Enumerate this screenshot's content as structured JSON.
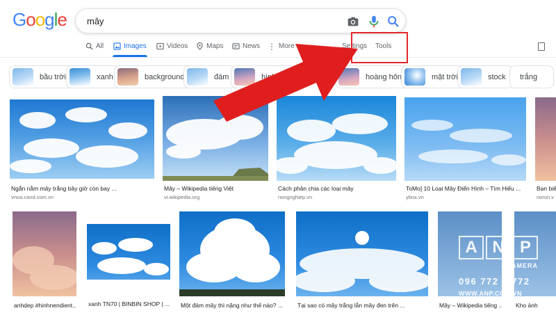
{
  "logo": {
    "letters": [
      "G",
      "o",
      "o",
      "g",
      "l",
      "e"
    ],
    "colors": [
      "#4285f4",
      "#ea4335",
      "#fbbc05",
      "#4285f4",
      "#34a853",
      "#ea4335"
    ]
  },
  "search": {
    "query": "mây",
    "camera_icon": "camera-icon",
    "mic_icon": "microphone-icon",
    "search_icon": "search-icon"
  },
  "nav": {
    "all": "All",
    "images": "Images",
    "videos": "Videos",
    "maps": "Maps",
    "news": "News",
    "more": "More",
    "settings": "Settings",
    "tools": "Tools"
  },
  "chips": [
    "bầu trời",
    "xanh",
    "background",
    "đám",
    "hình ảnh",
    "hoàng hôn",
    "mặt trời",
    "stock",
    "trắng"
  ],
  "results": [
    {
      "caption": "Ngắn nằm mây trắng bây giờ còn bay ...",
      "source": "vnoa.cand.com.vn"
    },
    {
      "caption": "Mây – Wikipedia tiếng Việt",
      "source": "vi.wikipedia.org"
    },
    {
      "caption": "Cách phân chia các loại mây",
      "source": "nongnghiep.vn"
    },
    {
      "caption": "ToMo] 10 Loại Mây Điển Hình – Tìm Hiểu ...",
      "source": "ybox.vn"
    },
    {
      "caption": "Bạn biế",
      "source": "noron.v"
    },
    {
      "caption": "anhdep #hinhnendient...",
      "source": ""
    },
    {
      "caption": "xanh TN70 | BINBIN SHOP | ...",
      "source": ""
    },
    {
      "caption": "Một đám mây thì nặng như thế nào? ...",
      "source": ""
    },
    {
      "caption": "Tại sao có mây trắng lẫn mây đen trên ...",
      "source": ""
    },
    {
      "caption": "Mây – Wikipedia tiếng ...",
      "source": ""
    },
    {
      "caption": "Kho ảnh",
      "source": ""
    }
  ],
  "watermark": {
    "letters": [
      "A",
      "N",
      "P"
    ],
    "tagline": "- CAMERA",
    "phone": "096 772 0 772",
    "site": "WWW.ANP.COM.VN"
  },
  "colors": {
    "accent": "#1a73e8",
    "highlight": "#e3262b",
    "arrow": "#e01e1e"
  }
}
